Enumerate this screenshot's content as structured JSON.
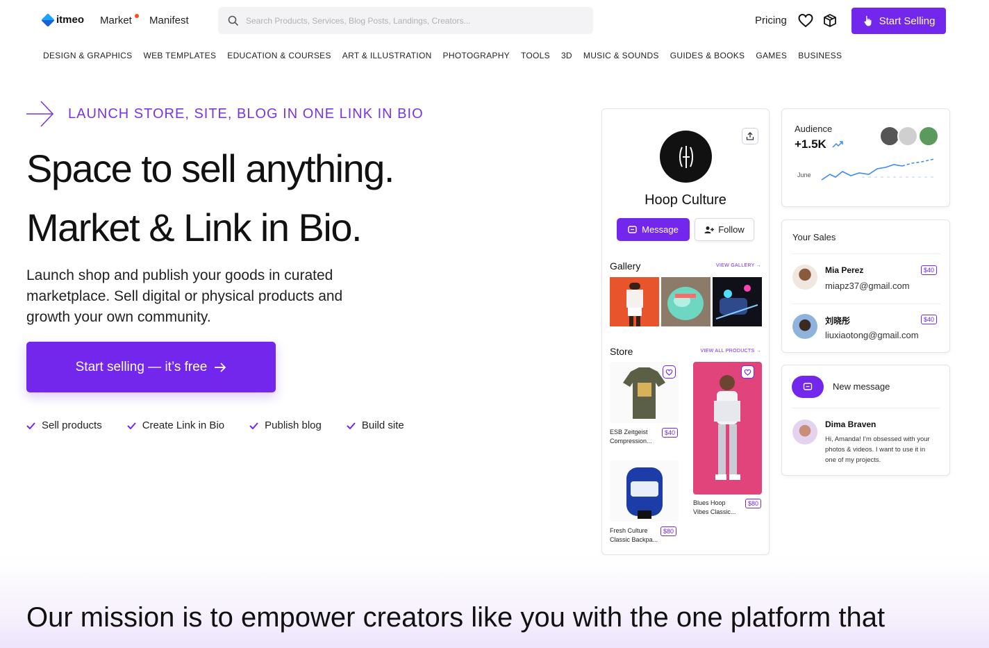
{
  "header": {
    "logo": "itmeo",
    "nav": [
      {
        "label": "Market"
      },
      {
        "label": "Manifest"
      }
    ],
    "search_placeholder": "Search Products, Services, Blog Posts, Landings, Creators...",
    "pricing": "Pricing",
    "start_selling": "Start Selling",
    "accent": "#7326ec"
  },
  "categories": [
    "DESIGN & GRAPHICS",
    "WEB TEMPLATES",
    "EDUCATION & COURSES",
    "ART & ILLUSTRATION",
    "PHOTOGRAPHY",
    "TOOLS",
    "3D",
    "MUSIC & SOUNDS",
    "GUIDES & BOOKS",
    "GAMES",
    "BUSINESS"
  ],
  "hero": {
    "tagline": "LAUNCH STORE, SITE, BLOG IN ONE LINK IN BIO",
    "title_line1": "Space to sell anything.",
    "title_line2": "Market & Link in Bio.",
    "description": "Launch shop and publish your goods in curated marketplace. Sell digital or physical products and growth your own community.",
    "cta": "Start selling — it’s free",
    "features": [
      "Sell products",
      "Create Link in Bio",
      "Publish blog",
      "Build site"
    ]
  },
  "profile": {
    "name": "Hoop Culture",
    "message_btn": "Message",
    "follow_btn": "Follow",
    "gallery_title": "Gallery",
    "gallery_link": "VIEW GALLERY",
    "store_title": "Store",
    "store_link": "VIEW ALL PRODUCTS",
    "products": [
      {
        "name_line1": "ESB Zeitgeist",
        "name_line2": "Compression...",
        "price": "$40"
      },
      {
        "name_line1": "Blues Hoop",
        "name_line2": "Vibes Classic...",
        "price": "$80"
      },
      {
        "name_line1": "Fresh Culture",
        "name_line2": "Classic Backpa...",
        "price": "$80"
      }
    ]
  },
  "audience": {
    "label": "Audience",
    "value": "+1.5K",
    "month": "June"
  },
  "sales": {
    "title": "Your Sales",
    "items": [
      {
        "name": "Mia Perez",
        "email": "miapz37@gmail.com",
        "price": "$40"
      },
      {
        "name": "刘晓彤",
        "email": "liuxiaotong@gmail.com",
        "price": "$40"
      }
    ]
  },
  "messages": {
    "new_message": "New message",
    "sender": "Dima Braven",
    "text": "Hi, Amanda! I'm obsessed with your photos & videos. I want to use it in one of my projects."
  },
  "mission": {
    "text": "Our mission is to empower creators like you with the one platform that"
  }
}
